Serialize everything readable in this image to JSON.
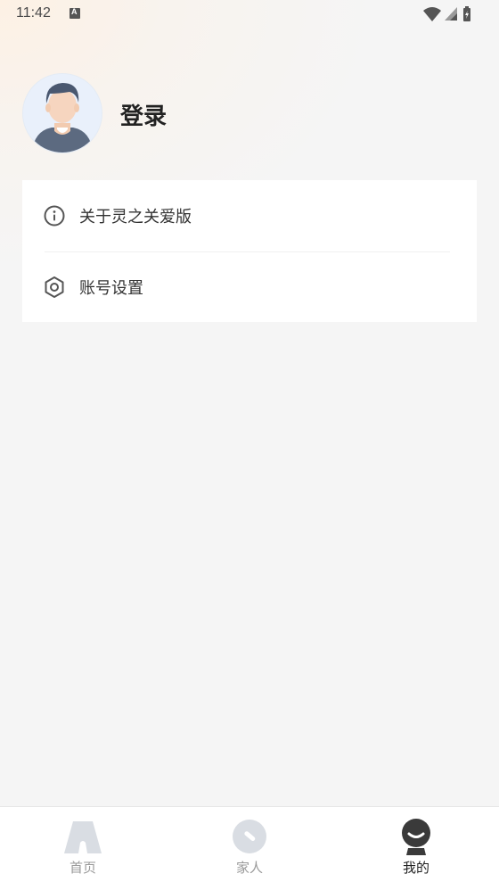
{
  "status_bar": {
    "time": "11:42",
    "notification_icon": "a-notification-icon",
    "wifi_icon": "wifi-icon",
    "signal_icon": "signal-icon",
    "battery_icon": "battery-charging-icon"
  },
  "profile": {
    "avatar_icon": "user-avatar",
    "login_label": "登录"
  },
  "menu": {
    "items": [
      {
        "label": "关于灵之关爱版",
        "icon": "info-icon"
      },
      {
        "label": "账号设置",
        "icon": "hexagon-settings-icon"
      }
    ]
  },
  "tab_bar": {
    "tabs": [
      {
        "label": "首页",
        "icon": "home-icon",
        "active": false
      },
      {
        "label": "家人",
        "icon": "family-icon",
        "active": false
      },
      {
        "label": "我的",
        "icon": "profile-icon",
        "active": true
      }
    ],
    "active_color": "#222222",
    "inactive_color": "#9a9a9a"
  }
}
